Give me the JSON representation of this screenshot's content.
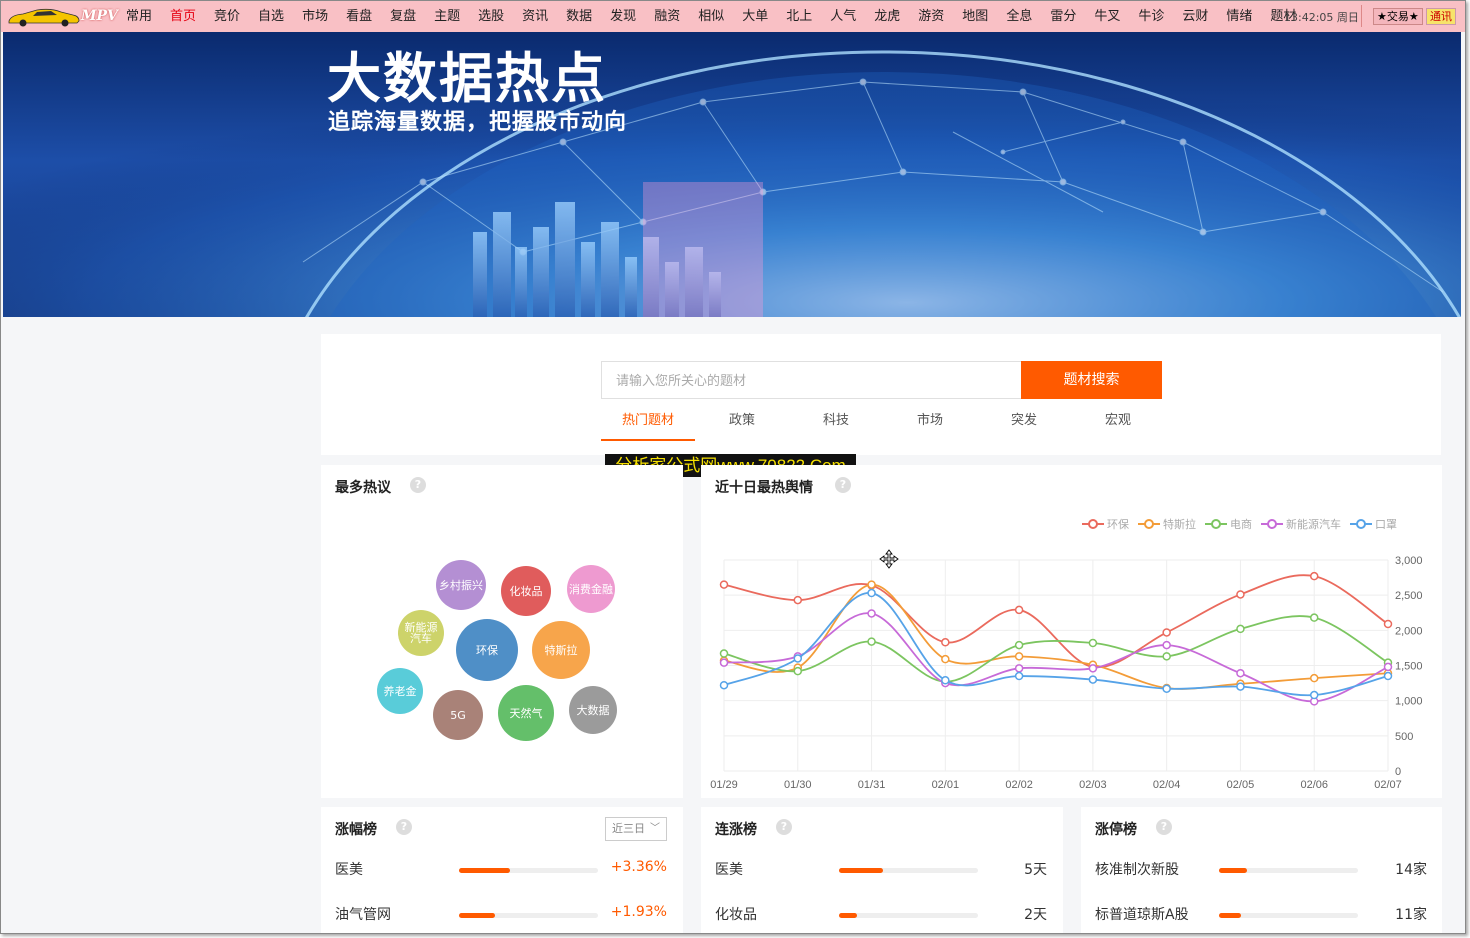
{
  "menubar": {
    "logo_text": "MPV",
    "items": [
      "常用",
      "首页",
      "竞价",
      "自选",
      "市场",
      "看盘",
      "复盘",
      "主题",
      "选股",
      "资讯",
      "数据",
      "发现",
      "融资",
      "相似",
      "大单",
      "北上",
      "人气",
      "龙虎",
      "游资",
      "地图",
      "全息",
      "雷分",
      "牛叉",
      "牛诊",
      "云财",
      "情绪",
      "题材"
    ],
    "active": "首页",
    "clock": "13:42:05 周日",
    "trade_label": "★交易★",
    "tx_label": "通讯"
  },
  "banner": {
    "title": "大数据热点",
    "subtitle": "追踪海量数据，把握股市动向"
  },
  "search": {
    "placeholder": "请输入您所关心的题材",
    "button": "题材搜索",
    "tabs": [
      "热门题材",
      "政策",
      "科技",
      "市场",
      "突发",
      "宏观"
    ],
    "active_tab": 0
  },
  "watermark": "分析家公式网www.70822.Com",
  "hot_topics": {
    "title": "最多热议",
    "help": "?",
    "bubbles": [
      {
        "label": "乡村振兴",
        "color": "#b48fd3"
      },
      {
        "label": "化妆品",
        "color": "#e05c5c"
      },
      {
        "label": "消费金融",
        "color": "#ee9ad0"
      },
      {
        "label": "新能源汽车",
        "color": "#cdd36a"
      },
      {
        "label": "环保",
        "color": "#4f8fc7"
      },
      {
        "label": "特斯拉",
        "color": "#f7a54b"
      },
      {
        "label": "养老金",
        "color": "#59ccd9"
      },
      {
        "label": "5G",
        "color": "#a98278"
      },
      {
        "label": "天然气",
        "color": "#64bf6a"
      },
      {
        "label": "大数据",
        "color": "#9b9b9b"
      }
    ]
  },
  "sentiment": {
    "title": "近十日最热舆情",
    "help": "?"
  },
  "chart_data": {
    "type": "line",
    "x": [
      "01/29",
      "01/30",
      "01/31",
      "02/01",
      "02/02",
      "02/03",
      "02/04",
      "02/05",
      "02/06",
      "02/07"
    ],
    "ylim": [
      0,
      3000
    ],
    "yticks": [
      "3,000",
      "2,500",
      "2,000",
      "1,500",
      "1,000",
      "500",
      "0"
    ],
    "grid": true,
    "legend_position": "top-right",
    "series": [
      {
        "name": "环保",
        "color": "#ea6a5d",
        "values": [
          2650,
          2430,
          2640,
          1830,
          2290,
          1480,
          1970,
          2510,
          2770,
          2090
        ]
      },
      {
        "name": "特斯拉",
        "color": "#f39c38",
        "values": [
          1570,
          1470,
          2650,
          1590,
          1630,
          1510,
          1180,
          1240,
          1320,
          1390
        ]
      },
      {
        "name": "电商",
        "color": "#7cc560",
        "values": [
          1670,
          1420,
          1840,
          1270,
          1790,
          1820,
          1630,
          2020,
          2180,
          1540
        ]
      },
      {
        "name": "新能源汽车",
        "color": "#c76ad8",
        "values": [
          1540,
          1630,
          2240,
          1250,
          1460,
          1460,
          1790,
          1390,
          990,
          1480
        ]
      },
      {
        "name": "口罩",
        "color": "#56a3e8",
        "values": [
          1220,
          1600,
          2530,
          1290,
          1350,
          1300,
          1170,
          1200,
          1080,
          1350
        ]
      }
    ]
  },
  "rankings": [
    {
      "title": "涨幅榜",
      "help": "?",
      "select": "近三日",
      "rows": [
        {
          "name": "医美",
          "ratio": 0.37,
          "value": "+3.36%"
        },
        {
          "name": "油气管网",
          "ratio": 0.26,
          "value": "+1.93%"
        }
      ]
    },
    {
      "title": "连涨榜",
      "help": "?",
      "rows": [
        {
          "name": "医美",
          "ratio": 0.32,
          "value": "5天"
        },
        {
          "name": "化妆品",
          "ratio": 0.13,
          "value": "2天"
        }
      ]
    },
    {
      "title": "涨停榜",
      "help": "?",
      "rows": [
        {
          "name": "核准制次新股",
          "ratio": 0.2,
          "value": "14家"
        },
        {
          "name": "标普道琼斯A股",
          "ratio": 0.16,
          "value": "11家"
        }
      ]
    }
  ]
}
